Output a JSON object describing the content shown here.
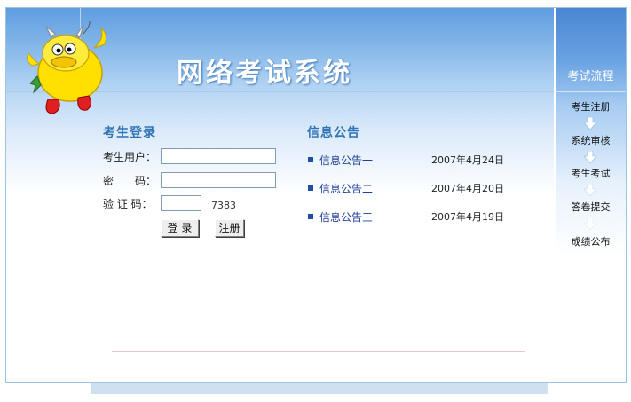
{
  "header": {
    "title": "网络考试系统"
  },
  "login": {
    "title": "考生登录",
    "user_label": "考生用户：",
    "password_label": "密　　码：",
    "captcha_label": "验 证 码：",
    "user_value": "",
    "password_value": "",
    "captcha_value": "",
    "captcha_code": "7383",
    "login_button": "登 录",
    "register_button": "注册"
  },
  "notices": {
    "title": "信息公告",
    "items": [
      {
        "label": "信息公告一",
        "date": "2007年4月24日"
      },
      {
        "label": "信息公告二",
        "date": "2007年4月20日"
      },
      {
        "label": "信息公告三",
        "date": "2007年4月19日"
      }
    ]
  },
  "flow": {
    "title": "考试流程",
    "steps": [
      "考生注册",
      "系统审核",
      "考生考试",
      "答卷提交",
      "成绩公布"
    ]
  },
  "colors": {
    "accent": "#2e74b5",
    "link": "#1f3f99",
    "header": "#5f9ddf"
  }
}
